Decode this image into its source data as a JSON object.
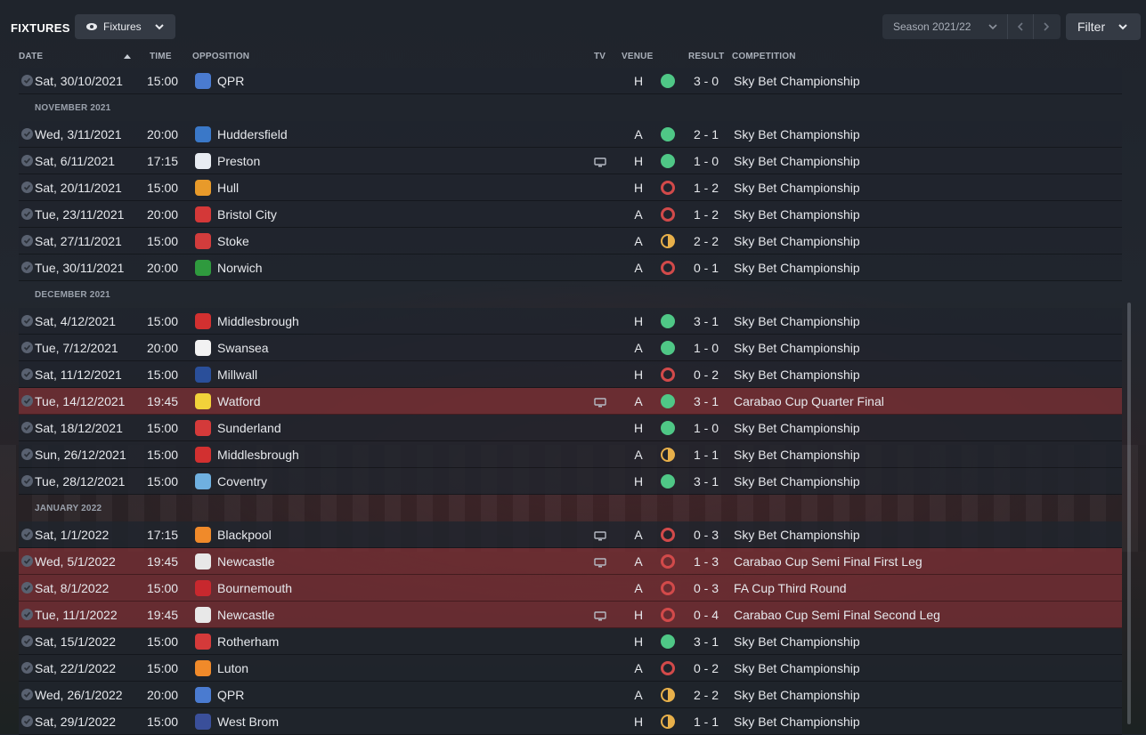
{
  "header": {
    "title": "FIXTURES",
    "view_label": "Fixtures",
    "season_label": "Season 2021/22",
    "filter_label": "Filter"
  },
  "columns": {
    "date": "DATE",
    "time": "TIME",
    "opposition": "OPPOSITION",
    "tv": "TV",
    "venue": "VENUE",
    "result": "RESULT",
    "competition": "COMPETITION"
  },
  "colors": {
    "win": "#4fc786",
    "loss": "#d24a4a",
    "draw": "#e8b04a",
    "cup_row": "#783034"
  },
  "rows": [
    {
      "type": "match",
      "date": "Sat, 30/10/2021",
      "time": "15:00",
      "opposition": "QPR",
      "crest": "#4a7bd0",
      "tv": false,
      "venue": "H",
      "outcome": "W",
      "score": "3 - 0",
      "competition": "Sky Bet Championship",
      "cup": false
    },
    {
      "type": "month",
      "label": "NOVEMBER 2021"
    },
    {
      "type": "match",
      "date": "Wed, 3/11/2021",
      "time": "20:00",
      "opposition": "Huddersfield",
      "crest": "#3a78c8",
      "tv": false,
      "venue": "A",
      "outcome": "W",
      "score": "2 - 1",
      "competition": "Sky Bet Championship",
      "cup": false
    },
    {
      "type": "match",
      "date": "Sat, 6/11/2021",
      "time": "17:15",
      "opposition": "Preston",
      "crest": "#e8ecf2",
      "tv": true,
      "venue": "H",
      "outcome": "W",
      "score": "1 - 0",
      "competition": "Sky Bet Championship",
      "cup": false
    },
    {
      "type": "match",
      "date": "Sat, 20/11/2021",
      "time": "15:00",
      "opposition": "Hull",
      "crest": "#e89a2a",
      "tv": false,
      "venue": "H",
      "outcome": "L",
      "score": "1 - 2",
      "competition": "Sky Bet Championship",
      "cup": false
    },
    {
      "type": "match",
      "date": "Tue, 23/11/2021",
      "time": "20:00",
      "opposition": "Bristol City",
      "crest": "#d43838",
      "tv": false,
      "venue": "A",
      "outcome": "L",
      "score": "1 - 2",
      "competition": "Sky Bet Championship",
      "cup": false
    },
    {
      "type": "match",
      "date": "Sat, 27/11/2021",
      "time": "15:00",
      "opposition": "Stoke",
      "crest": "#d23c3c",
      "tv": false,
      "venue": "A",
      "outcome": "D",
      "score": "2 - 2",
      "competition": "Sky Bet Championship",
      "cup": false
    },
    {
      "type": "match",
      "date": "Tue, 30/11/2021",
      "time": "20:00",
      "opposition": "Norwich",
      "crest": "#2f9a3e",
      "tv": false,
      "venue": "A",
      "outcome": "L",
      "score": "0 - 1",
      "competition": "Sky Bet Championship",
      "cup": false
    },
    {
      "type": "month",
      "label": "DECEMBER 2021"
    },
    {
      "type": "match",
      "date": "Sat, 4/12/2021",
      "time": "15:00",
      "opposition": "Middlesbrough",
      "crest": "#d23030",
      "tv": false,
      "venue": "H",
      "outcome": "W",
      "score": "3 - 1",
      "competition": "Sky Bet Championship",
      "cup": false
    },
    {
      "type": "match",
      "date": "Tue, 7/12/2021",
      "time": "20:00",
      "opposition": "Swansea",
      "crest": "#f2f2f2",
      "tv": false,
      "venue": "A",
      "outcome": "W",
      "score": "1 - 0",
      "competition": "Sky Bet Championship",
      "cup": false
    },
    {
      "type": "match",
      "date": "Sat, 11/12/2021",
      "time": "15:00",
      "opposition": "Millwall",
      "crest": "#2a4f9a",
      "tv": false,
      "venue": "H",
      "outcome": "L",
      "score": "0 - 2",
      "competition": "Sky Bet Championship",
      "cup": false
    },
    {
      "type": "match",
      "date": "Tue, 14/12/2021",
      "time": "19:45",
      "opposition": "Watford",
      "crest": "#f2d23a",
      "tv": true,
      "venue": "A",
      "outcome": "W",
      "score": "3 - 1",
      "competition": "Carabao Cup Quarter Final",
      "cup": true
    },
    {
      "type": "match",
      "date": "Sat, 18/12/2021",
      "time": "15:00",
      "opposition": "Sunderland",
      "crest": "#d43a3a",
      "tv": false,
      "venue": "H",
      "outcome": "W",
      "score": "1 - 0",
      "competition": "Sky Bet Championship",
      "cup": false
    },
    {
      "type": "match",
      "date": "Sun, 26/12/2021",
      "time": "15:00",
      "opposition": "Middlesbrough",
      "crest": "#d23030",
      "tv": false,
      "venue": "A",
      "outcome": "D",
      "score": "1 - 1",
      "competition": "Sky Bet Championship",
      "cup": false
    },
    {
      "type": "match",
      "date": "Tue, 28/12/2021",
      "time": "15:00",
      "opposition": "Coventry",
      "crest": "#6fb0e0",
      "tv": false,
      "venue": "H",
      "outcome": "W",
      "score": "3 - 1",
      "competition": "Sky Bet Championship",
      "cup": false
    },
    {
      "type": "month",
      "label": "JANUARY 2022"
    },
    {
      "type": "match",
      "date": "Sat, 1/1/2022",
      "time": "17:15",
      "opposition": "Blackpool",
      "crest": "#f08a2a",
      "tv": true,
      "venue": "A",
      "outcome": "L",
      "score": "0 - 3",
      "competition": "Sky Bet Championship",
      "cup": false
    },
    {
      "type": "match",
      "date": "Wed, 5/1/2022",
      "time": "19:45",
      "opposition": "Newcastle",
      "crest": "#e8e8e8",
      "tv": true,
      "venue": "A",
      "outcome": "L",
      "score": "1 - 3",
      "competition": "Carabao Cup Semi Final First Leg",
      "cup": true
    },
    {
      "type": "match",
      "date": "Sat, 8/1/2022",
      "time": "15:00",
      "opposition": "Bournemouth",
      "crest": "#c8282e",
      "tv": false,
      "venue": "A",
      "outcome": "L",
      "score": "0 - 3",
      "competition": "FA Cup Third Round",
      "cup": true
    },
    {
      "type": "match",
      "date": "Tue, 11/1/2022",
      "time": "19:45",
      "opposition": "Newcastle",
      "crest": "#e8e8e8",
      "tv": true,
      "venue": "H",
      "outcome": "L",
      "score": "0 - 4",
      "competition": "Carabao Cup Semi Final Second Leg",
      "cup": true
    },
    {
      "type": "match",
      "date": "Sat, 15/1/2022",
      "time": "15:00",
      "opposition": "Rotherham",
      "crest": "#d43a3a",
      "tv": false,
      "venue": "H",
      "outcome": "W",
      "score": "3 - 1",
      "competition": "Sky Bet Championship",
      "cup": false
    },
    {
      "type": "match",
      "date": "Sat, 22/1/2022",
      "time": "15:00",
      "opposition": "Luton",
      "crest": "#f08a2a",
      "tv": false,
      "venue": "A",
      "outcome": "L",
      "score": "0 - 2",
      "competition": "Sky Bet Championship",
      "cup": false
    },
    {
      "type": "match",
      "date": "Wed, 26/1/2022",
      "time": "20:00",
      "opposition": "QPR",
      "crest": "#4a7bd0",
      "tv": false,
      "venue": "A",
      "outcome": "D",
      "score": "2 - 2",
      "competition": "Sky Bet Championship",
      "cup": false
    },
    {
      "type": "match",
      "date": "Sat, 29/1/2022",
      "time": "15:00",
      "opposition": "West Brom",
      "crest": "#3a4f9a",
      "tv": false,
      "venue": "H",
      "outcome": "D",
      "score": "1 - 1",
      "competition": "Sky Bet Championship",
      "cup": false
    }
  ]
}
